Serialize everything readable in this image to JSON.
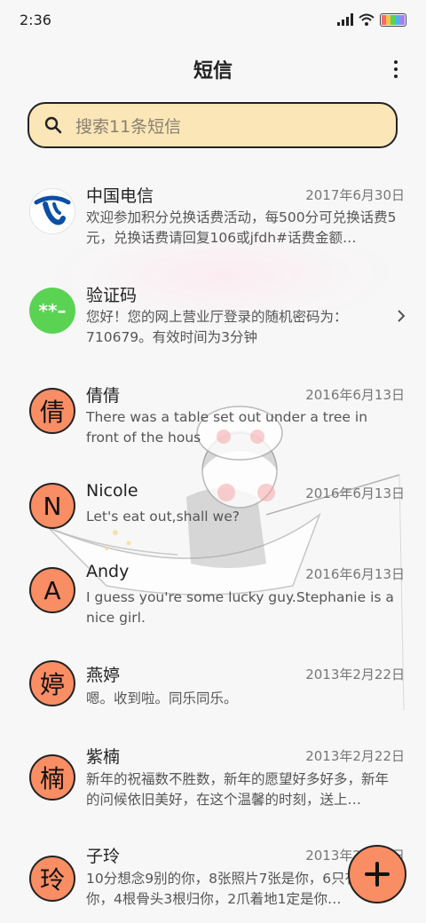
{
  "status": {
    "time": "2:36"
  },
  "header": {
    "title": "短信"
  },
  "search": {
    "placeholder": "搜索11条短信"
  },
  "colors": {
    "accent": "#f98e64",
    "search_bg": "#fbe6b8",
    "green_badge": "#5bd352",
    "telecom_blue": "#0a4fa6"
  },
  "conversations": [
    {
      "name": "中国电信",
      "date": "2017年6月30日",
      "preview": "欢迎参加积分兑换话费活动，每500分可兑换话费5元，兑换话费请回复106或jfdh#话费金额…",
      "avatar": "telecom-logo-icon"
    },
    {
      "name": "验证码",
      "date": "",
      "preview": "您好！您的网上营业厅登录的随机密码为：710679。有效时间为3分钟",
      "avatar": "**–"
    },
    {
      "name": "倩倩",
      "date": "2016年6月13日",
      "preview": "There was a table set out under a tree in front of the hous",
      "avatar": "倩"
    },
    {
      "name": "Nicole",
      "date": "2016年6月13日",
      "preview": "Let's eat out,shall we?",
      "avatar": "N"
    },
    {
      "name": "Andy",
      "date": "2016年6月13日",
      "preview": "I guess you're some lucky guy.Stephanie is a nice girl.",
      "avatar": "A"
    },
    {
      "name": "燕婷",
      "date": "2013年2月22日",
      "preview": "嗯。收到啦。同乐同乐。",
      "avatar": "婷"
    },
    {
      "name": "紫楠",
      "date": "2013年2月22日",
      "preview": "新年的祝福数不胜数，新年的愿望好多好多，新年的问候依旧美好，在这个温馨的时刻，送上…",
      "avatar": "楠"
    },
    {
      "name": "子玲",
      "date": "2013年2月22日",
      "preview": "10分想念9别的你，8张照片7张是你，6只有你只像你，4根骨头3根归你，2爪着地1定是你…",
      "avatar": "玲"
    }
  ]
}
